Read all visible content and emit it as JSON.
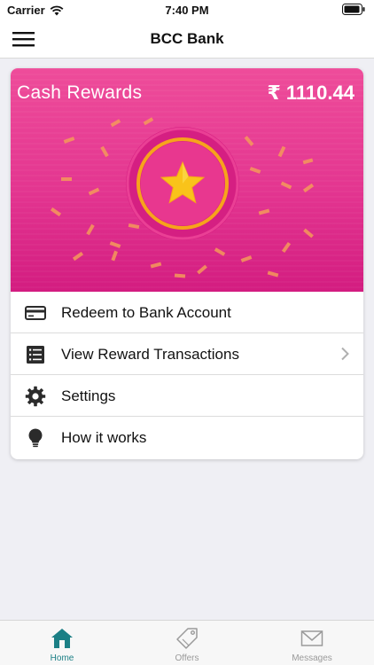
{
  "status_bar": {
    "carrier": "Carrier",
    "time": "7:40 PM"
  },
  "nav": {
    "title": "BCC Bank",
    "menu_icon": "hamburger-icon"
  },
  "rewards": {
    "title": "Cash Rewards",
    "amount": "₹ 1110.44",
    "badge_icon": "star-icon",
    "colors": {
      "banner": "#e33590",
      "ring": "#f7a31c",
      "star": "#f9c31a"
    }
  },
  "menu": {
    "items": [
      {
        "label": "Redeem to Bank Account",
        "icon": "credit-card-icon"
      },
      {
        "label": "View Reward Transactions",
        "icon": "list-icon",
        "has_chevron": true
      },
      {
        "label": "Settings",
        "icon": "gear-icon"
      },
      {
        "label": "How it works",
        "icon": "lightbulb-icon"
      }
    ]
  },
  "tabs": [
    {
      "label": "Home",
      "icon": "home-icon",
      "active": true
    },
    {
      "label": "Offers",
      "icon": "tag-icon",
      "active": false
    },
    {
      "label": "Messages",
      "icon": "envelope-icon",
      "active": false
    }
  ],
  "colors": {
    "accent": "#1b7f85",
    "tab_inactive": "#9a9a9a"
  }
}
